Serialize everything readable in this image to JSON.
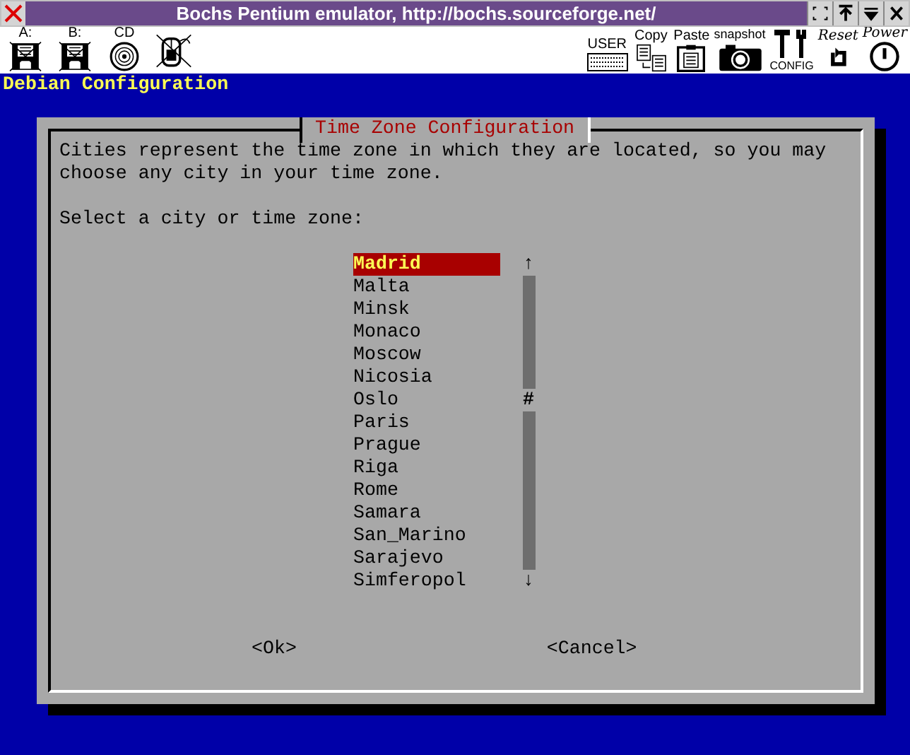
{
  "window": {
    "title": "Bochs Pentium emulator, http://bochs.sourceforge.net/"
  },
  "toolbar": {
    "left": [
      {
        "kind": "floppy",
        "label": "A:",
        "off": true
      },
      {
        "kind": "floppy",
        "label": "B:",
        "off": true
      },
      {
        "kind": "cdrom",
        "label": "CD",
        "off": false
      },
      {
        "kind": "mouse",
        "off": true
      }
    ],
    "right": [
      {
        "kind": "user",
        "label": "USER"
      },
      {
        "kind": "copy",
        "label": "Copy"
      },
      {
        "kind": "paste",
        "label": "Paste"
      },
      {
        "kind": "snapshot",
        "label": "snapshot"
      },
      {
        "kind": "config",
        "label": "CONFIG"
      },
      {
        "kind": "reset",
        "label": "Reset"
      },
      {
        "kind": "power",
        "label": "Power"
      }
    ]
  },
  "screen_title": "Debian Configuration",
  "dialog": {
    "title": "Time Zone Configuration",
    "description": [
      "Cities represent the time zone in which they are located, so you may",
      "choose any city in your time zone."
    ],
    "prompt": "Select a city or time zone:",
    "items": [
      {
        "label": "Madrid",
        "selected": true
      },
      {
        "label": "Malta",
        "selected": false
      },
      {
        "label": "Minsk",
        "selected": false
      },
      {
        "label": "Monaco",
        "selected": false
      },
      {
        "label": "Moscow",
        "selected": false
      },
      {
        "label": "Nicosia",
        "selected": false
      },
      {
        "label": "Oslo",
        "selected": false
      },
      {
        "label": "Paris",
        "selected": false
      },
      {
        "label": "Prague",
        "selected": false
      },
      {
        "label": "Riga",
        "selected": false
      },
      {
        "label": "Rome",
        "selected": false
      },
      {
        "label": "Samara",
        "selected": false
      },
      {
        "label": "San_Marino",
        "selected": false
      },
      {
        "label": "Sarajevo",
        "selected": false
      },
      {
        "label": "Simferopol",
        "selected": false
      }
    ],
    "scrollbar": {
      "up": "↑",
      "thumb": "#",
      "down": "↓"
    },
    "buttons": [
      "<Ok>",
      "<Cancel>"
    ]
  }
}
